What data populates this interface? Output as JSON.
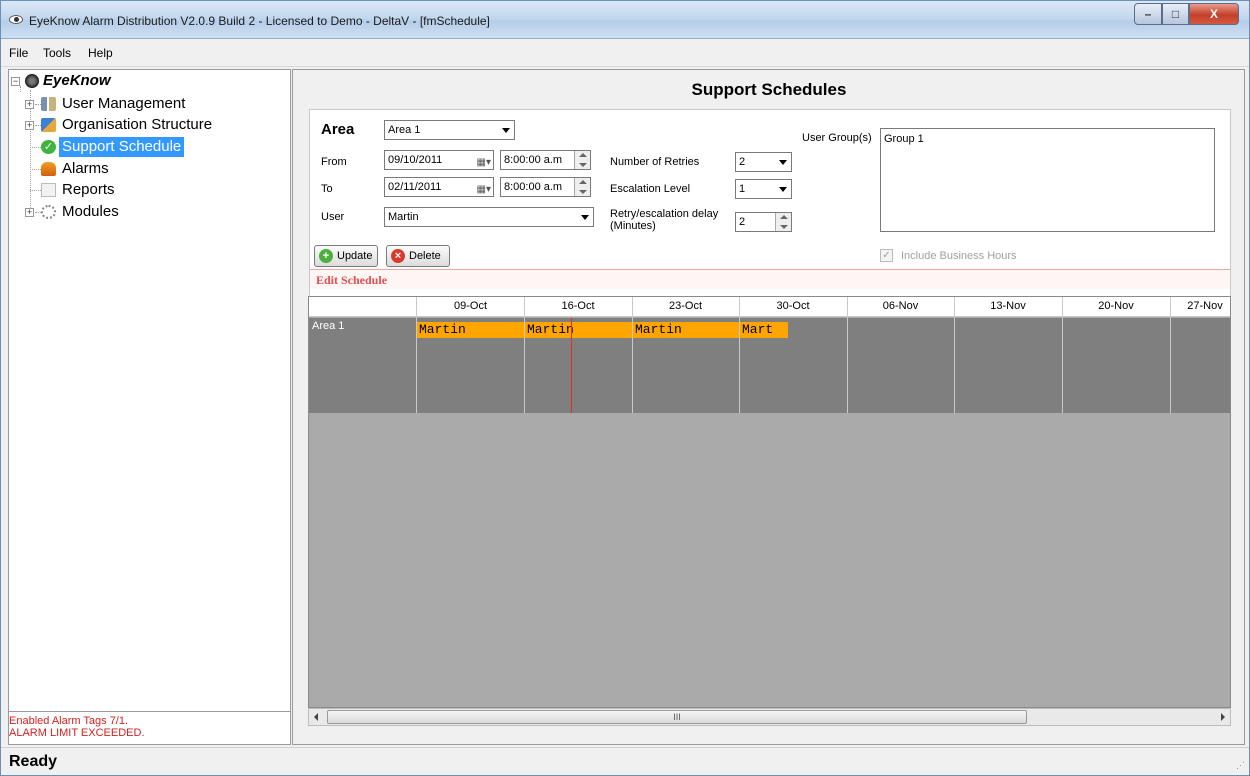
{
  "window": {
    "title": "EyeKnow Alarm Distribution V2.0.9 Build 2 - Licensed to Demo - DeltaV - [fmSchedule]",
    "minimize": "–",
    "maximize": "□",
    "close": "X"
  },
  "menu": [
    "File",
    "Tools",
    "Help"
  ],
  "tree": {
    "root": "EyeKnow",
    "items": [
      {
        "label": "User Management",
        "icon": "users-icon"
      },
      {
        "label": "Organisation Structure",
        "icon": "org-icon"
      },
      {
        "label": "Support Schedule",
        "icon": "check-icon",
        "selected": true
      },
      {
        "label": "Alarms",
        "icon": "alarm-bell-icon"
      },
      {
        "label": "Reports",
        "icon": "report-icon"
      },
      {
        "label": "Modules",
        "icon": "gear-icon"
      }
    ]
  },
  "status_messages": [
    "Enabled Alarm Tags 7/1.",
    "ALARM LIMIT EXCEEDED."
  ],
  "main": {
    "title": "Support Schedules",
    "form": {
      "area_label": "Area",
      "area_value": "Area 1",
      "from_label": "From",
      "from_date": "09/10/2011",
      "from_time": "8:00:00 a.m",
      "to_label": "To",
      "to_date": "02/11/2011",
      "to_time": "8:00:00 a.m",
      "user_label": "User",
      "user_value": "Martin",
      "retries_label": "Number of Retries",
      "retries_value": "2",
      "escalation_label": "Escalation Level",
      "escalation_value": "1",
      "delay_label": "Retry/escalation delay",
      "delay_label2": "(Minutes)",
      "delay_value": "2",
      "user_groups_label": "User Group(s)",
      "user_groups_value": "Group 1",
      "business_hours_label": "Include Business Hours",
      "business_hours_checked": true,
      "update_button": "Update",
      "delete_button": "Delete",
      "edit_schedule_label": "Edit Schedule"
    },
    "schedule": {
      "columns": [
        "09-Oct",
        "16-Oct",
        "23-Oct",
        "30-Oct",
        "06-Nov",
        "13-Nov",
        "20-Nov",
        "27-Nov"
      ],
      "row_label": "Area 1",
      "bars": [
        "Martin",
        "Martin",
        "Martin",
        "Mart"
      ],
      "bar_color": "#ffa500",
      "today_color": "#e03020"
    },
    "scroll_thumb": "III"
  },
  "statusbar": {
    "text": "Ready"
  }
}
